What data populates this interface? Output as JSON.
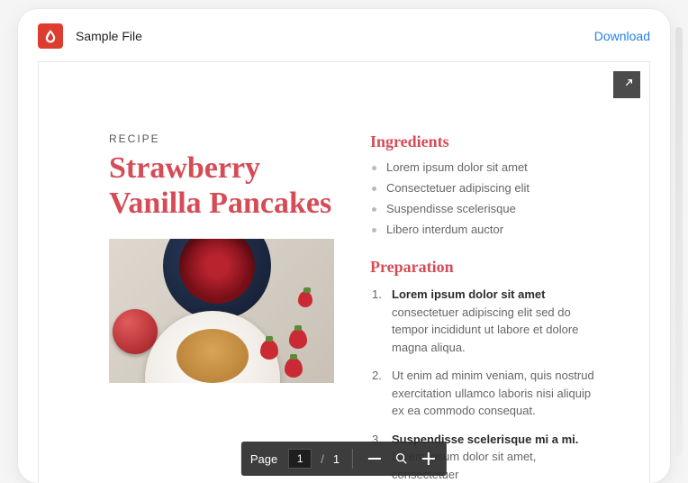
{
  "header": {
    "file_title": "Sample File",
    "download_label": "Download"
  },
  "toolbar": {
    "page_label": "Page",
    "current_page": "1",
    "separator": "/",
    "total_pages": "1"
  },
  "recipe": {
    "kicker": "RECIPE",
    "title": "Strawberry Vanilla Pancakes",
    "ingredients_heading": "Ingredients",
    "ingredients": [
      "Lorem ipsum dolor sit amet",
      "Consectetuer adipiscing elit",
      "Suspendisse scelerisque",
      "Libero interdum auctor"
    ],
    "preparation_heading": "Preparation",
    "steps": [
      {
        "lead": "Lorem ipsum dolor sit amet",
        "rest": " consectetuer adipiscing elit sed do tempor incididunt ut labore et dolore magna aliqua."
      },
      {
        "lead": "",
        "rest": "Ut enim ad minim veniam, quis nostrud exercitation ullamco laboris nisi aliquip ex ea commodo consequat."
      },
      {
        "lead": "Suspendisse scelerisque mi a mi.",
        "rest": " Lorem ipsum dolor sit amet, consectetuer"
      }
    ]
  }
}
